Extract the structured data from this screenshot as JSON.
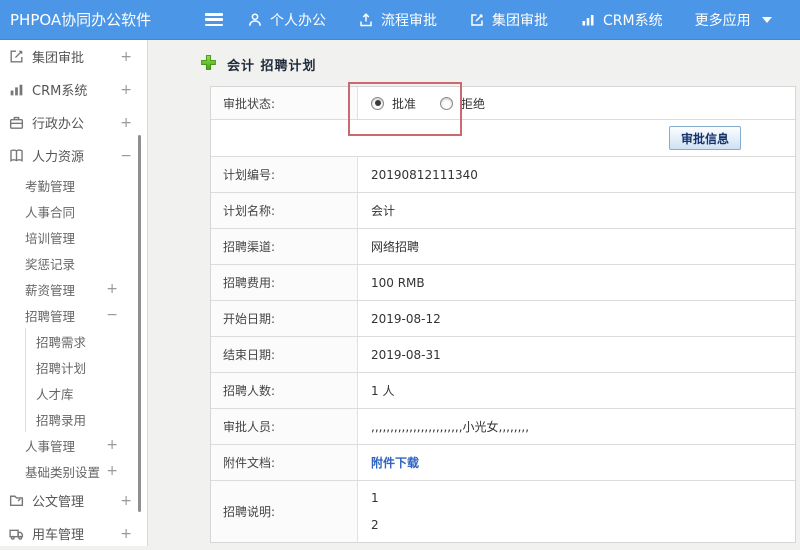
{
  "topbar": {
    "title": "PHPOA协同办公软件",
    "nav": [
      {
        "label": "个人办公",
        "icon": "person-icon"
      },
      {
        "label": "流程审批",
        "icon": "flow-icon"
      },
      {
        "label": "集团审批",
        "icon": "edit-icon"
      },
      {
        "label": "CRM系统",
        "icon": "chart-icon"
      },
      {
        "label": "更多应用",
        "icon": "caret-down-icon"
      }
    ]
  },
  "sidebar": {
    "items": [
      {
        "label": "集团审批",
        "level": 1,
        "icon": "edit-icon",
        "expander": "+"
      },
      {
        "label": "CRM系统",
        "level": 1,
        "icon": "chart-icon",
        "expander": "+"
      },
      {
        "label": "行政办公",
        "level": 1,
        "icon": "briefcase-icon",
        "expander": "+"
      },
      {
        "label": "人力资源",
        "level": 1,
        "icon": "book-icon",
        "expander": "−"
      },
      {
        "label": "考勤管理",
        "level": 2,
        "expander": ""
      },
      {
        "label": "人事合同",
        "level": 2,
        "expander": ""
      },
      {
        "label": "培训管理",
        "level": 2,
        "expander": ""
      },
      {
        "label": "奖惩记录",
        "level": 2,
        "expander": ""
      },
      {
        "label": "薪资管理",
        "level": 2,
        "expander": "+"
      },
      {
        "label": "招聘管理",
        "level": 2,
        "expander": "−"
      },
      {
        "label": "招聘需求",
        "level": 3,
        "expander": ""
      },
      {
        "label": "招聘计划",
        "level": 3,
        "expander": ""
      },
      {
        "label": "人才库",
        "level": 3,
        "expander": ""
      },
      {
        "label": "招聘录用",
        "level": 3,
        "expander": ""
      },
      {
        "label": "人事管理",
        "level": 2,
        "expander": "+"
      },
      {
        "label": "基础类别设置",
        "level": 2,
        "expander": "+"
      },
      {
        "label": "公文管理",
        "level": 1,
        "icon": "document-icon",
        "expander": "+"
      },
      {
        "label": "用车管理",
        "level": 1,
        "icon": "truck-icon",
        "expander": "+"
      }
    ]
  },
  "main": {
    "page_title": "会计 招聘计划",
    "approval": {
      "label": "审批状态:",
      "options": [
        {
          "label": "批准",
          "selected": true
        },
        {
          "label": "拒绝",
          "selected": false
        }
      ]
    },
    "approve_button_label": "审批信息",
    "fields": [
      {
        "label": "计划编号:",
        "value": "20190812111340"
      },
      {
        "label": "计划名称:",
        "value": "会计"
      },
      {
        "label": "招聘渠道:",
        "value": "网络招聘"
      },
      {
        "label": "招聘费用:",
        "value": "100 RMB"
      },
      {
        "label": "开始日期:",
        "value": "2019-08-12"
      },
      {
        "label": "结束日期:",
        "value": "2019-08-31"
      },
      {
        "label": "招聘人数:",
        "value": "1 人"
      },
      {
        "label": "审批人员:",
        "value": ",,,,,,,,,,,,,,,,,,,,,,,,小光女,,,,,,,,"
      },
      {
        "label": "附件文档:",
        "value": "附件下载",
        "is_link": true
      },
      {
        "label": "招聘说明:",
        "lines": [
          "1",
          "2"
        ]
      }
    ]
  },
  "colors": {
    "topbar_blue": "#4b96e6",
    "annotation_red": "#c96a6e",
    "link_blue": "#2f64c0",
    "plus_green": "#5cb827",
    "button_face": "#cfe1f3"
  }
}
